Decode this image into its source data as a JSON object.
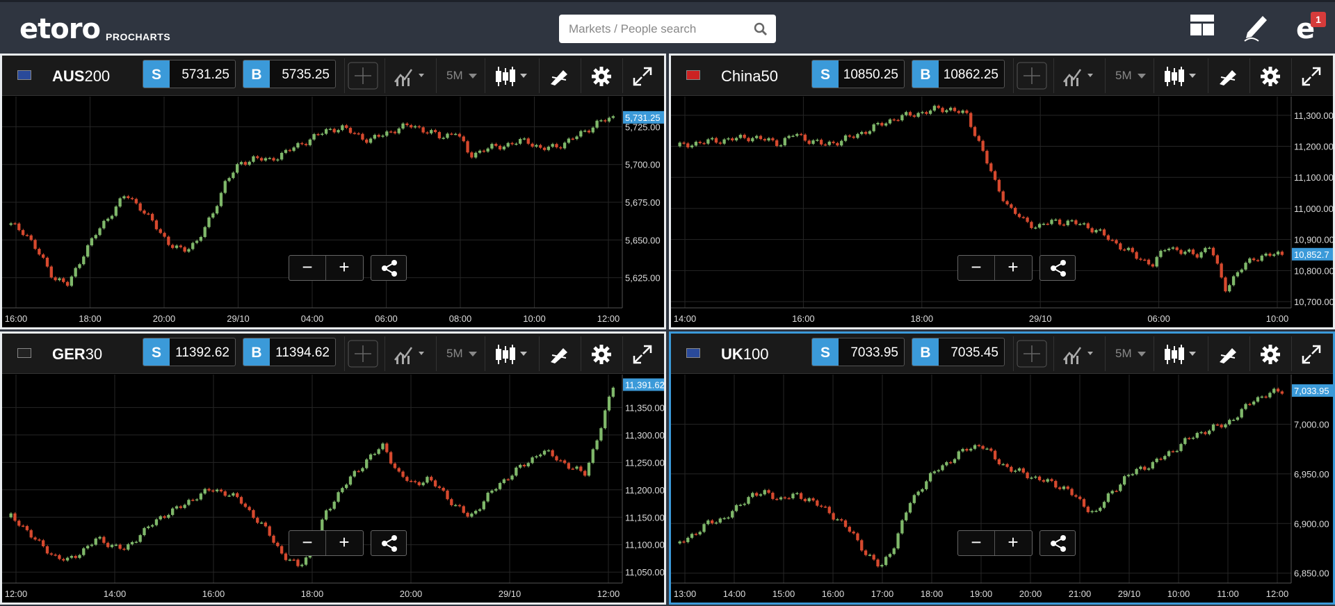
{
  "app": {
    "logo": "etoro",
    "logo_sub": "PROCHARTS",
    "notifications": "1"
  },
  "search": {
    "placeholder": "Markets / People search"
  },
  "panels": [
    {
      "symbol_bold": "AUS",
      "symbol_rest": "200",
      "sell_label": "S",
      "sell": "5731.25",
      "buy_label": "B",
      "buy": "5735.25",
      "timeframe": "5M",
      "price_tag": "5,731.25",
      "y_ticks": [
        "5,725.00",
        "5,700.00",
        "5,675.00",
        "5,650.00",
        "5,625.00"
      ],
      "x_ticks": [
        "16:00",
        "18:00",
        "20:00",
        "29/10",
        "04:00",
        "06:00",
        "08:00",
        "10:00",
        "12:00"
      ],
      "series": [
        5660,
        5655,
        5640,
        5625,
        5620,
        5640,
        5655,
        5668,
        5680,
        5672,
        5660,
        5648,
        5642,
        5650,
        5665,
        5690,
        5700,
        5705,
        5702,
        5708,
        5712,
        5718,
        5722,
        5725,
        5720,
        5716,
        5720,
        5724,
        5726,
        5722,
        5718,
        5722,
        5706,
        5710,
        5712,
        5714,
        5716,
        5710,
        5712,
        5716,
        5722,
        5728,
        5731
      ]
    },
    {
      "symbol_bold": "",
      "symbol_rest": "China50",
      "sell_label": "S",
      "sell": "10850.25",
      "buy_label": "B",
      "buy": "10862.25",
      "timeframe": "5M",
      "price_tag": "10,852.7",
      "y_ticks": [
        "11,300.00",
        "11,200.00",
        "11,100.00",
        "11,000.00",
        "10,900.00",
        "10,800.00",
        "10,700.00"
      ],
      "x_ticks": [
        "14:00",
        "16:00",
        "18:00",
        "29/10",
        "06:00",
        "10:00"
      ],
      "series": [
        11200,
        11210,
        11215,
        11220,
        11225,
        11230,
        11220,
        11210,
        11240,
        11220,
        11205,
        11215,
        11230,
        11250,
        11270,
        11290,
        11300,
        11310,
        11320,
        11320,
        11300,
        11200,
        11080,
        11000,
        10960,
        10940,
        10960,
        10955,
        10950,
        10930,
        10900,
        10870,
        10840,
        10820,
        10880,
        10860,
        10850,
        10880,
        10740,
        10800,
        10840,
        10850,
        10852
      ]
    },
    {
      "symbol_bold": "GER",
      "symbol_rest": "30",
      "sell_label": "S",
      "sell": "11392.62",
      "buy_label": "B",
      "buy": "11394.62",
      "timeframe": "5M",
      "price_tag": "11,391.62",
      "y_ticks": [
        "11,350.00",
        "11,300.00",
        "11,250.00",
        "11,200.00",
        "11,150.00",
        "11,100.00",
        "11,050.00"
      ],
      "x_ticks": [
        "12:00",
        "14:00",
        "16:00",
        "18:00",
        "20:00",
        "29/10",
        "12:00"
      ],
      "series": [
        11150,
        11130,
        11100,
        11080,
        11070,
        11090,
        11110,
        11100,
        11090,
        11120,
        11140,
        11160,
        11170,
        11190,
        11200,
        11195,
        11180,
        11150,
        11120,
        11080,
        11060,
        11090,
        11160,
        11200,
        11230,
        11260,
        11280,
        11230,
        11210,
        11220,
        11200,
        11170,
        11150,
        11180,
        11210,
        11230,
        11250,
        11270,
        11260,
        11240,
        11230,
        11300,
        11391
      ]
    },
    {
      "symbol_bold": "UK",
      "symbol_rest": "100",
      "sell_label": "S",
      "sell": "7033.95",
      "buy_label": "B",
      "buy": "7035.45",
      "timeframe": "5M",
      "price_tag": "7,033.95",
      "y_ticks": [
        "7,000.00",
        "6,950.00",
        "6,900.00",
        "6,850.00"
      ],
      "x_ticks": [
        "13:00",
        "14:00",
        "15:00",
        "16:00",
        "17:00",
        "18:00",
        "19:00",
        "20:00",
        "21:00",
        "29/10",
        "10:00",
        "11:00",
        "12:00"
      ],
      "series": [
        6880,
        6890,
        6900,
        6905,
        6915,
        6930,
        6930,
        6925,
        6928,
        6925,
        6915,
        6905,
        6890,
        6870,
        6855,
        6880,
        6920,
        6940,
        6955,
        6965,
        6975,
        6980,
        6965,
        6955,
        6950,
        6945,
        6940,
        6935,
        6920,
        6910,
        6930,
        6945,
        6955,
        6960,
        6970,
        6980,
        6990,
        6995,
        7000,
        7010,
        7025,
        7030,
        7034
      ]
    }
  ],
  "colors": {
    "up": "#7fb86a",
    "down": "#d6492e",
    "accent": "#3b9ad9",
    "grid": "#262626"
  }
}
